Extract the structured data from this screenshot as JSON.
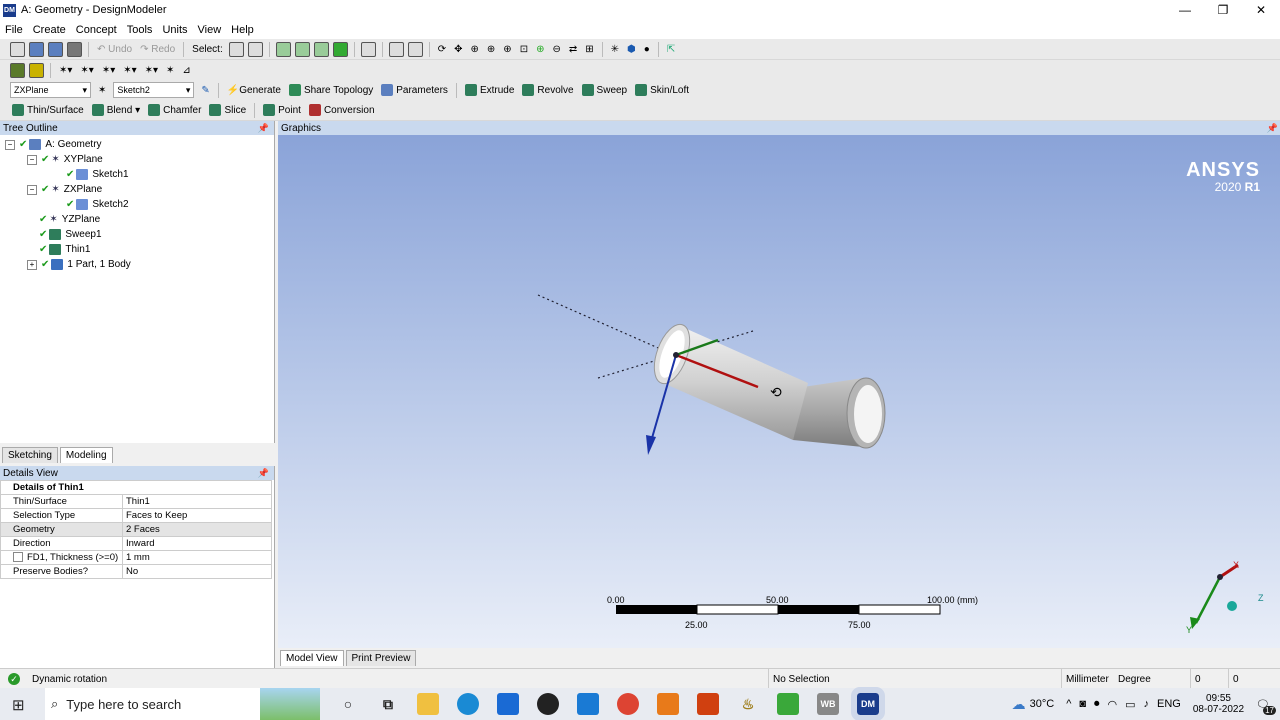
{
  "window": {
    "title": "A: Geometry - DesignModeler",
    "app_icon": "DM",
    "min": "—",
    "max": "❐",
    "close": "✕"
  },
  "menu": [
    "File",
    "Create",
    "Concept",
    "Tools",
    "Units",
    "View",
    "Help"
  ],
  "toolbar1": {
    "undo": "Undo",
    "redo": "Redo",
    "select": "Select:"
  },
  "toolbar3": {
    "plane_select": "ZXPlane",
    "sketch_select": "Sketch2",
    "generate": "Generate",
    "share_topology": "Share Topology",
    "parameters": "Parameters",
    "extrude": "Extrude",
    "revolve": "Revolve",
    "sweep": "Sweep",
    "skin_loft": "Skin/Loft"
  },
  "toolbar4": {
    "thin_surface": "Thin/Surface",
    "blend": "Blend",
    "chamfer": "Chamfer",
    "slice": "Slice",
    "point": "Point",
    "conversion": "Conversion"
  },
  "tree": {
    "header": "Tree Outline",
    "items": [
      {
        "label": "A: Geometry"
      },
      {
        "label": "XYPlane"
      },
      {
        "label": "Sketch1"
      },
      {
        "label": "ZXPlane"
      },
      {
        "label": "Sketch2"
      },
      {
        "label": "YZPlane"
      },
      {
        "label": "Sweep1"
      },
      {
        "label": "Thin1"
      },
      {
        "label": "1 Part, 1 Body"
      }
    ]
  },
  "left_tabs": [
    "Sketching",
    "Modeling"
  ],
  "details": {
    "header": "Details View",
    "title": "Details of Thin1",
    "rows": [
      {
        "key": "Thin/Surface",
        "value": "Thin1"
      },
      {
        "key": "Selection Type",
        "value": "Faces to Keep"
      },
      {
        "key": "Geometry",
        "value": "2 Faces"
      },
      {
        "key": "Direction",
        "value": "Inward"
      },
      {
        "key": "FD1, Thickness (>=0)",
        "value": "1 mm"
      },
      {
        "key": "Preserve Bodies?",
        "value": "No"
      }
    ]
  },
  "graphics": {
    "header": "Graphics",
    "logo": "ANSYS",
    "version_prefix": "2020 ",
    "version_suffix": "R1",
    "scale": {
      "l0": "0.00",
      "l50": "50.00",
      "l100": "100.00 (mm)",
      "l25": "25.00",
      "l75": "75.00"
    },
    "triad": {
      "x": "X",
      "z": "Z",
      "y": "Y"
    }
  },
  "view_tabs": [
    "Model View",
    "Print Preview"
  ],
  "status": {
    "message": "Dynamic rotation",
    "selection": "No Selection",
    "units_length": "Millimeter",
    "units_angle": "Degree",
    "v1": "0",
    "v2": "0"
  },
  "taskbar": {
    "search_placeholder": "Type here to search",
    "temperature": "30°C",
    "lang": "ENG",
    "time": "09:55",
    "date": "08-07-2022",
    "notif_count": "17",
    "wb_label": "WB",
    "dm_label": "DM"
  },
  "colors": {
    "accent": "#1a3c8c",
    "viewport_top": "#8aa3d8",
    "viewport_bottom": "#e9eef8",
    "check": "#1d9b1d"
  }
}
